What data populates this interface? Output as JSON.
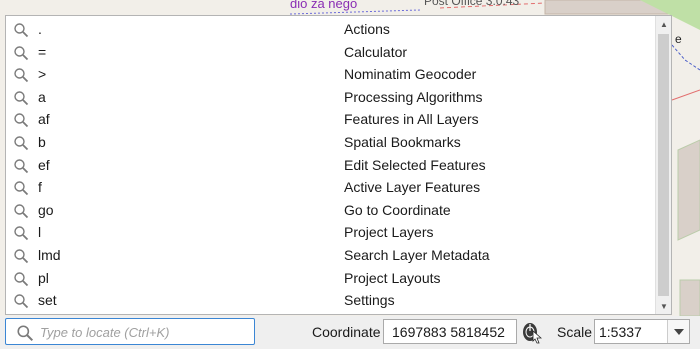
{
  "map": {
    "label_purple": "dio za nego",
    "label_gray": "Post Office 3.0.43",
    "label_edge": "e"
  },
  "results": [
    {
      "prefix": ".",
      "name": "Actions"
    },
    {
      "prefix": "=",
      "name": "Calculator"
    },
    {
      "prefix": ">",
      "name": "Nominatim Geocoder"
    },
    {
      "prefix": "a",
      "name": "Processing Algorithms"
    },
    {
      "prefix": "af",
      "name": "Features in All Layers"
    },
    {
      "prefix": "b",
      "name": "Spatial Bookmarks"
    },
    {
      "prefix": "ef",
      "name": "Edit Selected Features"
    },
    {
      "prefix": "f",
      "name": "Active Layer Features"
    },
    {
      "prefix": "go",
      "name": "Go to Coordinate"
    },
    {
      "prefix": "l",
      "name": "Project Layers"
    },
    {
      "prefix": "lmd",
      "name": "Search Layer Metadata"
    },
    {
      "prefix": "pl",
      "name": "Project Layouts"
    },
    {
      "prefix": "set",
      "name": "Settings"
    }
  ],
  "statusbar": {
    "locator_placeholder": "Type to locate (Ctrl+K)",
    "coordinate_label": "Coordinate",
    "coordinate_value": "1697883  5818452",
    "scale_label": "Scale",
    "scale_value": "1:5337"
  },
  "icons": {
    "search": "magnifier-icon",
    "coordinate_toggle": "mouse-pointer-icon",
    "scale_dropdown": "chevron-down-icon"
  },
  "colors": {
    "input_focus_border": "#3b86d4",
    "map_label_purple": "#8a2db4"
  }
}
